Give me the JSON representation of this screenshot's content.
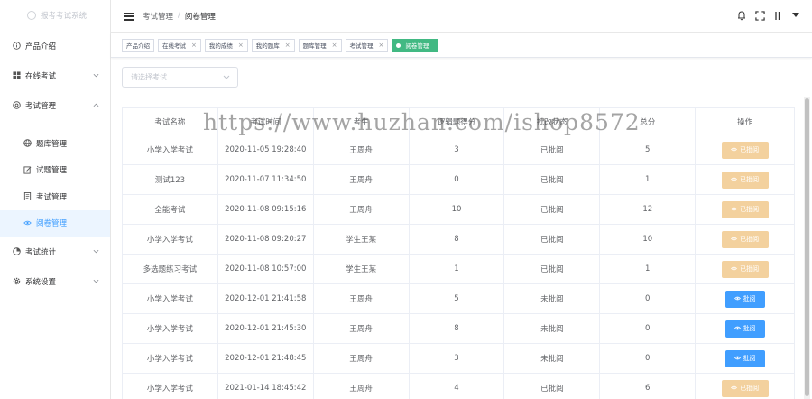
{
  "sidebar": {
    "logo_text": "报考考试系统",
    "items": [
      {
        "label": "产品介绍",
        "icon": "info-circle-icon"
      },
      {
        "label": "在线考试",
        "icon": "grid-icon",
        "expandable": true
      },
      {
        "label": "考试管理",
        "icon": "settings-icon",
        "expandable": true,
        "expanded": true
      },
      {
        "label": "考试统计",
        "icon": "pie-chart-icon",
        "expandable": true
      },
      {
        "label": "系统设置",
        "icon": "gear-icon",
        "expandable": true
      }
    ],
    "subitems": [
      {
        "label": "题库管理",
        "icon": "globe-icon"
      },
      {
        "label": "试题管理",
        "icon": "edit-icon"
      },
      {
        "label": "考试管理",
        "icon": "document-icon"
      },
      {
        "label": "阅卷管理",
        "icon": "eye-icon",
        "active": true
      }
    ]
  },
  "header": {
    "breadcrumb": [
      "考试管理",
      "阅卷管理"
    ],
    "separator": "/"
  },
  "tags": [
    {
      "label": "产品介绍",
      "closable": false
    },
    {
      "label": "在线考试",
      "closable": true
    },
    {
      "label": "我的成绩",
      "closable": true
    },
    {
      "label": "我的题库",
      "closable": true
    },
    {
      "label": "题库管理",
      "closable": true
    },
    {
      "label": "考试管理",
      "closable": true
    },
    {
      "label": "阅卷管理",
      "closable": false,
      "active": true
    }
  ],
  "filter": {
    "placeholder": "请选择考试"
  },
  "table": {
    "columns": [
      "考试名称",
      "考试时间",
      "考生",
      "逻辑题得分",
      "批改状态",
      "总分",
      "操作"
    ],
    "rows": [
      {
        "name": "小学入学考试",
        "time": "2020-11-05 19:28:40",
        "student": "王周舟",
        "score": "3",
        "status": "已批阅",
        "total": "5",
        "action": "已批阅",
        "done": true
      },
      {
        "name": "测试123",
        "time": "2020-11-07 11:34:50",
        "student": "王周舟",
        "score": "0",
        "status": "已批阅",
        "total": "1",
        "action": "已批阅",
        "done": true
      },
      {
        "name": "全能考试",
        "time": "2020-11-08 09:15:16",
        "student": "王周舟",
        "score": "10",
        "status": "已批阅",
        "total": "12",
        "action": "已批阅",
        "done": true
      },
      {
        "name": "小学入学考试",
        "time": "2020-11-08 09:20:27",
        "student": "学生王某",
        "score": "8",
        "status": "已批阅",
        "total": "10",
        "action": "已批阅",
        "done": true
      },
      {
        "name": "多选题练习考试",
        "time": "2020-11-08 10:57:00",
        "student": "学生王某",
        "score": "1",
        "status": "已批阅",
        "total": "1",
        "action": "已批阅",
        "done": true
      },
      {
        "name": "小学入学考试",
        "time": "2020-12-01 21:41:58",
        "student": "王周舟",
        "score": "5",
        "status": "未批阅",
        "total": "0",
        "action": "批阅",
        "done": false
      },
      {
        "name": "小学入学考试",
        "time": "2020-12-01 21:45:30",
        "student": "王周舟",
        "score": "8",
        "status": "未批阅",
        "total": "0",
        "action": "批阅",
        "done": false
      },
      {
        "name": "小学入学考试",
        "time": "2020-12-01 21:48:45",
        "student": "王周舟",
        "score": "3",
        "status": "未批阅",
        "total": "0",
        "action": "批阅",
        "done": false
      },
      {
        "name": "小学入学考试",
        "time": "2021-01-14 18:45:42",
        "student": "王周舟",
        "score": "4",
        "status": "已批阅",
        "total": "6",
        "action": "已批阅",
        "done": true
      }
    ]
  },
  "watermark": "https://www.huzhan.com/ishop8572",
  "colors": {
    "accent": "#409eff",
    "active_tag": "#42b983",
    "reviewed_button": "#f3d19e",
    "review_button": "#409eff"
  }
}
